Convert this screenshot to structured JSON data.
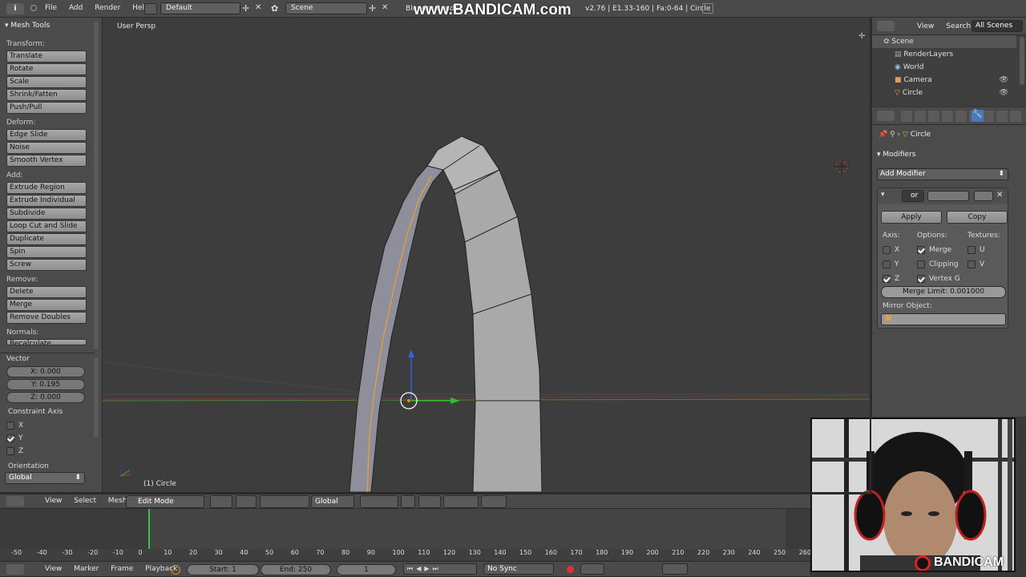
{
  "top_bar": {
    "menus": [
      "File",
      "Add",
      "Render",
      "Help"
    ],
    "layout": "Default",
    "scene": "Scene",
    "render_engine": "Blender Render",
    "stats": "v2.76 | E1.33-160 | Fa:0-64 | Circle",
    "watermark": "www.BANDICAM.com"
  },
  "tool_shelf": {
    "title": "Mesh Tools",
    "sections": [
      {
        "label": "Transform:",
        "buttons": [
          "Translate",
          "Rotate",
          "Scale",
          "Shrink/Fatten",
          "Push/Pull"
        ]
      },
      {
        "label": "Deform:",
        "buttons": [
          "Edge Slide",
          "Noise",
          "Smooth Vertex"
        ]
      },
      {
        "label": "Add:",
        "buttons": [
          "Extrude Region",
          "Extrude Individual",
          "Subdivide",
          "Loop Cut and Slide",
          "Duplicate",
          "Spin",
          "Screw"
        ]
      },
      {
        "label": "Remove:",
        "buttons": [
          "Delete",
          "Merge",
          "Remove Doubles"
        ]
      },
      {
        "label": "Normals:",
        "buttons": [
          "Recalculate"
        ]
      }
    ]
  },
  "operator_panel": {
    "title": "Vector",
    "x": "X: 0.000",
    "y": "Y: 0.195",
    "z": "Z: 0.000",
    "constraint_label": "Constraint Axis",
    "axes": [
      {
        "label": "X",
        "checked": false
      },
      {
        "label": "Y",
        "checked": true
      },
      {
        "label": "Z",
        "checked": false
      }
    ],
    "orientation_label": "Orientation",
    "orientation_value": "Global"
  },
  "viewport": {
    "view_label": "User Persp",
    "object_label": "(1) Circle"
  },
  "view3d_header": {
    "menus": [
      "View",
      "Select",
      "Mesh"
    ],
    "mode": "Edit Mode",
    "orientation": "Global"
  },
  "outliner": {
    "menus": [
      "View",
      "Search"
    ],
    "filter": "All Scenes",
    "items": [
      "Scene",
      "RenderLayers",
      "World",
      "Camera",
      "Circle"
    ]
  },
  "properties": {
    "breadcrumb": "Circle",
    "panel_title": "Modifiers",
    "add_modifier": "Add Modifier",
    "modifier_name": "or",
    "apply": "Apply",
    "copy": "Copy",
    "axis_label": "Axis:",
    "options_label": "Options:",
    "textures_label": "Textures:",
    "axis": [
      {
        "label": "X",
        "checked": false
      },
      {
        "label": "Y",
        "checked": false
      },
      {
        "label": "Z",
        "checked": true
      }
    ],
    "options": [
      {
        "label": "Merge",
        "checked": true
      },
      {
        "label": "Clipping",
        "checked": false
      },
      {
        "label": "Vertex G",
        "checked": true
      }
    ],
    "textures": [
      {
        "label": "U",
        "checked": false
      },
      {
        "label": "V",
        "checked": false
      }
    ],
    "merge_limit": "Merge Limit: 0.001000",
    "mirror_object_label": "Mirror Object:"
  },
  "timeline": {
    "ticks": [
      "-50",
      "-40",
      "-30",
      "-20",
      "-10",
      "0",
      "10",
      "20",
      "30",
      "40",
      "50",
      "60",
      "70",
      "80",
      "90",
      "100",
      "110",
      "120",
      "130",
      "140",
      "150",
      "160",
      "170",
      "180",
      "190",
      "200",
      "210",
      "220",
      "230",
      "240",
      "250",
      "260"
    ],
    "current_frame_marker": 0,
    "menus": [
      "View",
      "Marker",
      "Frame",
      "Playback"
    ],
    "start": "Start: 1",
    "end": "End: 250",
    "frame": "1",
    "sync": "No Sync"
  },
  "webcam": {
    "watermark": "BANDICAM"
  }
}
